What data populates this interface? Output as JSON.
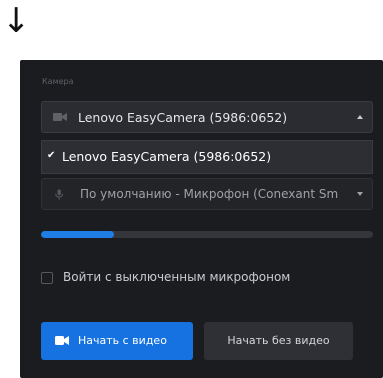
{
  "decor": {
    "arrow": "↓"
  },
  "camera_section": {
    "label": "Камера",
    "selected": "Lenovo EasyCamera (5986:0652)",
    "icon": "camera-icon"
  },
  "camera_dropdown": {
    "options": [
      {
        "label": "Lenovo EasyCamera (5986:0652)",
        "checked": true
      }
    ]
  },
  "microphone": {
    "selected": "По умолчанию - Микрофон (Conexant Sm",
    "icon": "microphone-icon"
  },
  "mic_level": {
    "fraction": 0.22
  },
  "mute_option": {
    "label": "Войти с выключенным микрофоном",
    "checked": false
  },
  "buttons": {
    "start_with_video": "Начать с видео",
    "start_without_video": "Начать без видео"
  },
  "colors": {
    "panel_bg": "#1b1c20",
    "accent": "#1672e0",
    "meter_fill": "#1f7ee6"
  }
}
